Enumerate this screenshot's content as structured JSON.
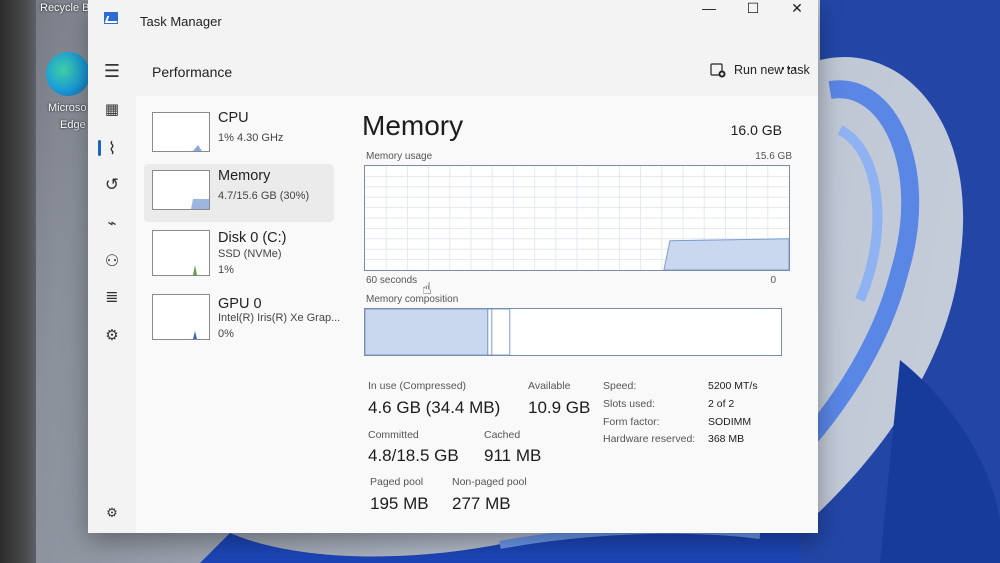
{
  "desktop": {
    "recycle_bin_label": "Recycle B",
    "edge_label_line1": "Microso",
    "edge_label_line2": "Edge"
  },
  "window": {
    "title": "Task Manager",
    "minimize_glyph": "—",
    "maximize_glyph": "☐",
    "close_glyph": "✕"
  },
  "header": {
    "page_title": "Performance",
    "run_new_task": "Run new task",
    "more_glyph": "⋯"
  },
  "nav": {
    "menu_glyph": "☰",
    "processes_glyph": "▦",
    "performance_glyph": "⌇",
    "app_history_glyph": "↺",
    "startup_glyph": "⌁",
    "users_glyph": "⚇",
    "details_glyph": "≣",
    "services_glyph": "⚙",
    "settings_glyph": "⚙"
  },
  "perf_list": [
    {
      "title": "CPU",
      "line1": "1%  4.30 GHz",
      "line2": ""
    },
    {
      "title": "Memory",
      "line1": "4.7/15.6 GB (30%)",
      "line2": ""
    },
    {
      "title": "Disk 0 (C:)",
      "line1": "SSD (NVMe)",
      "line2": "1%"
    },
    {
      "title": "GPU 0",
      "line1": "Intel(R) Iris(R) Xe Grap...",
      "line2": "0%"
    }
  ],
  "memory": {
    "title": "Memory",
    "total": "16.0 GB",
    "usage_label": "Memory usage",
    "usage_max": "15.6 GB",
    "time_left": "60 seconds",
    "time_right": "0",
    "composition_label": "Memory composition",
    "in_use_label": "In use (Compressed)",
    "in_use_value": "4.6 GB (34.4 MB)",
    "available_label": "Available",
    "available_value": "10.9 GB",
    "committed_label": "Committed",
    "committed_value": "4.8/18.5 GB",
    "cached_label": "Cached",
    "cached_value": "911 MB",
    "paged_pool_label": "Paged pool",
    "paged_pool_value": "195 MB",
    "nonpaged_pool_label": "Non-paged pool",
    "nonpaged_pool_value": "277 MB",
    "details": [
      {
        "label": "Speed:",
        "value": "5200 MT/s"
      },
      {
        "label": "Slots used:",
        "value": "2 of 2"
      },
      {
        "label": "Form factor:",
        "value": "SODIMM"
      },
      {
        "label": "Hardware reserved:",
        "value": "368 MB"
      }
    ],
    "usage_fraction": 0.3,
    "composition_in_use_fraction": 0.3
  },
  "colors": {
    "accent": "#1a66c7",
    "graph_fill": "#c9d8ef",
    "graph_line": "#7a9cd0"
  }
}
